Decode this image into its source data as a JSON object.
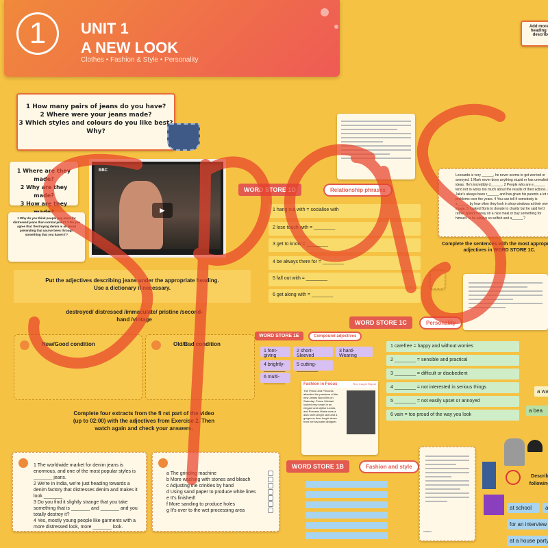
{
  "header": {
    "unit_number": "1",
    "title_line1": "UNIT 1",
    "title_line2": "A NEW LOOK",
    "subtitle": "Clothes • Fashion & Style • Personality"
  },
  "top_right_note": "Add more w heading to describe",
  "questions_card": {
    "q1": "1 How many pairs of jeans do you have?",
    "q2": "2 Where were your jeans made?",
    "q3": "3 Which styles and colours do you like best?",
    "q3b": "Why?"
  },
  "small_card_1": {
    "l1": "1 Where are they made?",
    "l2": "2 Why are they made?",
    "l3": "3 How are they made?"
  },
  "small_card_2": {
    "text": "1 Why do you think people pay more for distressed jeans than normal jeans? 2 Do you agree that 'destroying denim is all about pretending that you've been through something that you haven't'?"
  },
  "adjectives_task": {
    "instruction": "Put the adjectives describing jeans under the appropriate heading. Use a dictionary if necessary.",
    "words": "destroyed/ distressed /immaculate/ pristine /second-hand /vintage",
    "col_good": "New/Good condition",
    "col_bad": "Old/Bad condition"
  },
  "extracts_task": {
    "instruction": "Complete four extracts from the fi rst part of the video (up to 02:00) with the adjectives from Exercise 2. Then watch again and check your answers."
  },
  "extract_list": [
    "1  The worldwide market for denim jeans is enormous, and one of the most popular styles is _______ jeans.",
    "2  We're in India, we're just heading towards a denim factory that distresses denim and makes it look _______",
    "3  Do you find it slightly strange that you take something that is _______ and _______ and you totally destroy it?",
    "4  Yes, mostly young people like garments with a more distressed look, more _______ look."
  ],
  "process_list": [
    "a  The grinding machine",
    "b  More washing with stones and bleach",
    "c  Adjusting the crinkles by hand",
    "d  Using sand paper to produce white lines",
    "e  It's finished!",
    "f  More sanding to produce holes",
    "g  It's over to the wet processing area"
  ],
  "word_store_1d": {
    "tag": "WORD STORE 1D",
    "pill": "Relationship phrases",
    "rows": [
      "1 hang out with = socialise with",
      "2 lose touch with = ________",
      "3 get to know = ________",
      "4 be always there for = ________",
      "5 fall out with = ________",
      "6 get along with = ________"
    ]
  },
  "word_store_1c": {
    "tag": "WORD STORE 1C",
    "pill": "Personality",
    "rows": [
      "1 carefree = happy and without worries",
      "2 ________ = sensible and practical",
      "3 ________ = difficult or disobedient",
      "4 ________ = not interested in serious things",
      "5 ________ = not easily upset or annoyed",
      "6 vain = too proud of the way you look"
    ]
  },
  "word_store_1e": {
    "tag": "WORD STORE 1E",
    "pill": "Compound adjectives",
    "chips": [
      "1 font- giving",
      "2 short- Sleeved",
      "3 hard- Wearing",
      "4 brightly- ________",
      "5 cutting- ________",
      "6 multi- ________"
    ]
  },
  "word_store_1b": {
    "tag": "WORD STORE 1B",
    "pill": "Fashion and style"
  },
  "fashion_focus": {
    "title": "Fashion in Focus",
    "subtitle": "Red Carpet Report",
    "body": "The Prince and Princess attended the premiere of the new James Bond film on Saturday. Prince Michael looked very smart in an elegant and stylish tuxedo, and Princess Maria wore a dark knee-length skirt and a gorgeous floor-length dress from her favourite designer."
  },
  "complete_sentences": {
    "instruction": "Complete the sentences with the most appropriate adjectives in WORD STORE 1C.",
    "body": "Leonardo is very ______, he never seems to get worried or annoyed. 1 Mark never does anything stupid or has unrealistic ideas. He's incredibly d______. 2 People who are e______ tend not to worry too much about the results of their actions. 3 Jake's always been r______ and has given his parents a lot of problems over the years. 4 You can tell if somebody is s______ by how often they look in shop windows at their own image. 5 I asked Boris to donate to charity but he said he'd rather spend money on a nice meal or buy something for himself. Is he always so selfish and a______?"
  },
  "describe_panel": {
    "heading": "Describ following",
    "labels": [
      "at school",
      "at t",
      "for an interview",
      "at a house party"
    ],
    "side_labels": [
      "a wa",
      "a bea"
    ]
  },
  "overlay_text": "Spas",
  "colors": {
    "background": "#f6c243",
    "header_from": "#f08a3b",
    "header_to": "#ef5a55",
    "accent_red": "#e35a4f",
    "scribble_red": "#e8402a"
  }
}
